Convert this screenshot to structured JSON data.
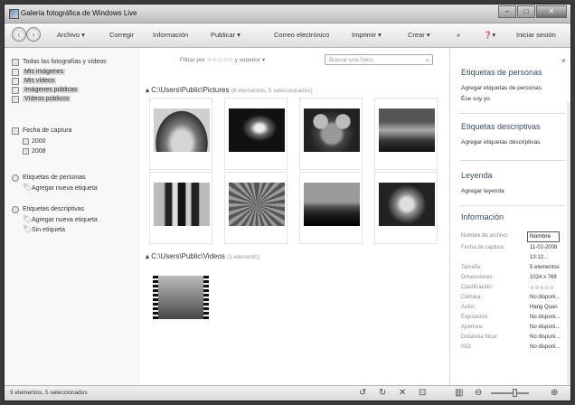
{
  "window": {
    "title": "Galería fotográfica de Windows Live",
    "controls": {
      "min": "–",
      "max": "□",
      "close": "✕"
    }
  },
  "toolbar": {
    "back_icon": "back-arrow-icon",
    "forward_icon": "forward-arrow-icon",
    "menus": [
      "Archivo ▾",
      "Corregir",
      "Información",
      "Publicar ▾",
      "Correo electrónico",
      "Imprimir ▾",
      "Crear ▾",
      "»"
    ],
    "help_label": "❓▾",
    "signin_label": "Iniciar sesión"
  },
  "sidebar": {
    "all_label": "Todas las fotografías y vídeos",
    "items": [
      {
        "label": "Mis imágenes",
        "selected": true
      },
      {
        "label": "Mis vídeos",
        "selected": true
      },
      {
        "label": "Imágenes públicas",
        "selected": true
      },
      {
        "label": "Vídeos públicos",
        "selected": true
      }
    ],
    "date_label": "Fecha de captura",
    "dates": [
      "2000",
      "2008"
    ],
    "people_label": "Etiquetas de personas",
    "people_add": "Agregar nueva etiqueta",
    "desc_label": "Etiquetas descriptivas",
    "desc_add": "Agregar nueva etiqueta",
    "untagged": "Sin etiqueta"
  },
  "filter": {
    "prefix": "Filtrar por",
    "stars": "☆☆☆☆☆",
    "suffix": "y superior ▾",
    "search_placeholder": "Buscar una fotos"
  },
  "groups": [
    {
      "path": "C:\\Users\\Public\\Pictures",
      "count": "(8 elementos, 5 seleccionados)"
    },
    {
      "path": "C:\\Users\\Public\\Videos",
      "count": "(1 elemento)"
    }
  ],
  "details": {
    "people_title": "Etiquetas de personas",
    "people_add": "Agregar etiquetas de personas",
    "people_self": "Ése soy yo",
    "desc_title": "Etiquetas descriptivas",
    "desc_add": "Agregar etiquetas descriptivas",
    "caption_title": "Leyenda",
    "caption_add": "Agregar leyenda",
    "info_title": "Información",
    "filename_label": "Nombre de archivo:",
    "filename_value": "Nombre",
    "props": [
      {
        "k": "Fecha de captura:",
        "v": "11-02-2008"
      },
      {
        "k": "",
        "v": "13:12..."
      },
      {
        "k": "Tamaño:",
        "v": "5 elementos"
      },
      {
        "k": "Dimensiones:",
        "v": "1024 x 768"
      },
      {
        "k": "Clasificación:",
        "v": "☆☆☆☆☆"
      },
      {
        "k": "Cámara:",
        "v": "No disponi..."
      },
      {
        "k": "Autor:",
        "v": "Hang Quan"
      },
      {
        "k": "Exposición:",
        "v": "No disponi..."
      },
      {
        "k": "Apertura:",
        "v": "No disponi..."
      },
      {
        "k": "Distancia focal:",
        "v": "No disponi..."
      },
      {
        "k": "ISO:",
        "v": "No disponi..."
      }
    ]
  },
  "status": {
    "text": "9 elementos, 5 seleccionados",
    "icons": {
      "rotate_left": "↺",
      "rotate_right": "↻",
      "delete": "✕",
      "slideshow": "⊡",
      "view": "▥",
      "zoom_out": "⊖",
      "zoom_in": "⊕"
    }
  }
}
